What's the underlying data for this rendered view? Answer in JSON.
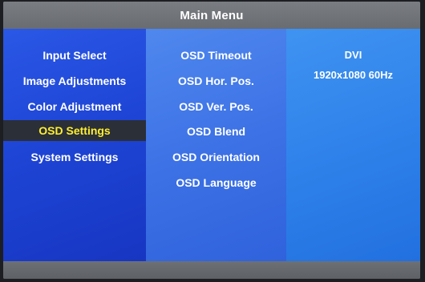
{
  "title": "Main Menu",
  "main_menu": {
    "items": [
      {
        "label": "Input Select"
      },
      {
        "label": "Image Adjustments"
      },
      {
        "label": "Color Adjustment"
      },
      {
        "label": "OSD Settings",
        "selected": true
      },
      {
        "label": "System Settings"
      }
    ]
  },
  "submenu": {
    "items": [
      {
        "label": "OSD Timeout"
      },
      {
        "label": "OSD Hor. Pos."
      },
      {
        "label": "OSD Ver. Pos."
      },
      {
        "label": "OSD Blend"
      },
      {
        "label": "OSD Orientation"
      },
      {
        "label": "OSD Language"
      }
    ]
  },
  "info": {
    "input": "DVI",
    "resolution": "1920x1080 60Hz"
  },
  "colors": {
    "selected_text": "#ffee30",
    "selected_bg": "#2b2f37",
    "left_panel": "#1e45d6",
    "middle_panel": "#3d72e6",
    "right_panel": "#2f82ea",
    "title_bar": "#6e7176"
  }
}
